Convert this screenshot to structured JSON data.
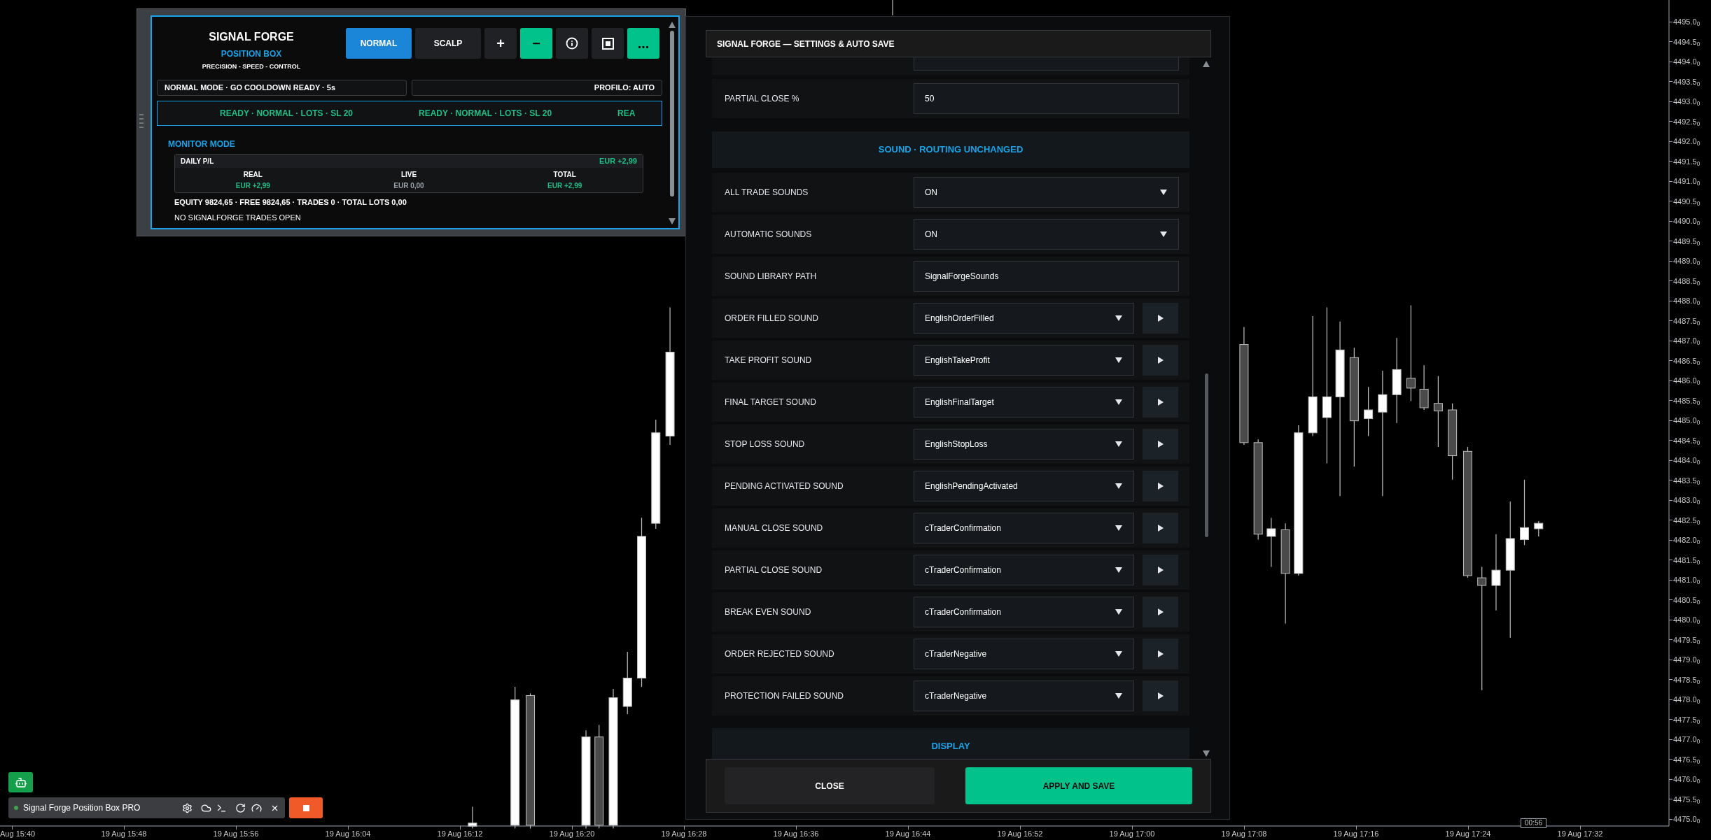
{
  "position_box": {
    "title": "SIGNAL FORGE",
    "subtitle": "POSITION BOX",
    "tagline": "PRECISION - SPEED - CONTROL",
    "buttons": [
      {
        "kind": "mode",
        "label": "NORMAL",
        "selected": true
      },
      {
        "kind": "mode",
        "label": "SCALP",
        "selected": false
      },
      {
        "kind": "glyph",
        "label": "+",
        "highlighted": false
      },
      {
        "kind": "glyph",
        "label": "−",
        "highlighted": true
      },
      {
        "kind": "info",
        "highlighted": false
      },
      {
        "kind": "window",
        "highlighted": false
      },
      {
        "kind": "glyph",
        "label": "...",
        "highlighted": true
      }
    ],
    "status_left": "NORMAL MODE · GO COOLDOWN READY · 5s",
    "status_right": "PROFILO: AUTO",
    "ticker": [
      "READY · NORMAL · LOTS · SL 20",
      "READY · NORMAL · LOTS · SL 20",
      "REA"
    ],
    "monitor_title": "MONITOR MODE",
    "daily_pl": {
      "label": "DAILY P/L",
      "value": "EUR +2,99",
      "columns": [
        {
          "label": "REAL",
          "value": "EUR +2,99",
          "color": "#1fbf86"
        },
        {
          "label": "LIVE",
          "value": "EUR 0,00",
          "color": "#9aa3ad"
        },
        {
          "label": "TOTAL",
          "value": "EUR +2,99",
          "color": "#1fbf86"
        }
      ]
    },
    "equity_line": "EQUITY 9824,65 · FREE 9824,65 · TRADES 0 · TOTAL LOTS 0,00",
    "trades_line": "NO SIGNALFORGE TRADES OPEN"
  },
  "settings": {
    "title": "SIGNAL FORGE — SETTINGS & AUTO SAVE",
    "rows": [
      {
        "kind": "input",
        "label": "PARTIAL CLOSE %",
        "value": "50"
      },
      {
        "kind": "section",
        "label": "SOUND · ROUTING UNCHANGED"
      },
      {
        "kind": "select",
        "label": "ALL TRADE SOUNDS",
        "value": "ON"
      },
      {
        "kind": "select",
        "label": "AUTOMATIC SOUNDS",
        "value": "ON"
      },
      {
        "kind": "input",
        "label": "SOUND LIBRARY PATH",
        "value": "SignalForgeSounds"
      },
      {
        "kind": "sound",
        "label": "ORDER FILLED SOUND",
        "value": "EnglishOrderFilled"
      },
      {
        "kind": "sound",
        "label": "TAKE PROFIT SOUND",
        "value": "EnglishTakeProfit"
      },
      {
        "kind": "sound",
        "label": "FINAL TARGET SOUND",
        "value": "EnglishFinalTarget"
      },
      {
        "kind": "sound",
        "label": "STOP LOSS SOUND",
        "value": "EnglishStopLoss"
      },
      {
        "kind": "sound",
        "label": "PENDING ACTIVATED SOUND",
        "value": "EnglishPendingActivated"
      },
      {
        "kind": "sound",
        "label": "MANUAL CLOSE SOUND",
        "value": "cTraderConfirmation"
      },
      {
        "kind": "sound",
        "label": "PARTIAL CLOSE SOUND",
        "value": "cTraderConfirmation"
      },
      {
        "kind": "sound",
        "label": "BREAK EVEN SOUND",
        "value": "cTraderConfirmation"
      },
      {
        "kind": "sound",
        "label": "ORDER REJECTED SOUND",
        "value": "cTraderNegative"
      },
      {
        "kind": "sound",
        "label": "PROTECTION FAILED SOUND",
        "value": "cTraderNegative"
      },
      {
        "kind": "section",
        "label": "DISPLAY"
      }
    ],
    "close_button": "CLOSE",
    "apply_button": "APPLY AND SAVE"
  },
  "bot_bar": {
    "name": "Signal Forge Position Box PRO"
  },
  "price_axis": [
    "4495.0$_{0}$",
    "4494.5$_{0}$",
    "4494.0$_{0}$",
    "4493.5$_{0}$",
    "4493.0$_{0}$",
    "4492.5$_{0}$",
    "4492.0$_{0}$",
    "4491.5$_{0}$",
    "4491.0$_{0}$",
    "4490.5$_{0}$",
    "4490.0$_{0}$",
    "4489.5$_{0}$",
    "4489.0$_{0}$",
    "4488.5$_{0}$",
    "4488.0$_{0}$",
    "4487.5$_{0}$",
    "4487.0$_{0}$",
    "4486.5$_{0}$",
    "4486.0$_{0}$",
    "4485.5$_{0}$",
    "4485.0$_{0}$",
    "4484.5$_{0}$",
    "4484.0$_{0}$",
    "4483.5$_{0}$",
    "4483.0$_{0}$",
    "4482.5$_{0}$",
    "4482.0$_{0}$",
    "4481.5$_{0}$",
    "4481.0$_{0}$",
    "4480.5$_{0}$",
    "4480.0$_{0}$",
    "4479.5$_{0}$",
    "4479.0$_{0}$",
    "4478.5$_{0}$",
    "4478.0$_{0}$",
    "4477.5$_{0}$",
    "4477.0$_{0}$",
    "4476.5$_{0}$",
    "4476.0$_{0}$",
    "4475.5$_{0}$",
    "4475.0$_{0}$"
  ],
  "time_axis": [
    "Aug 15:40",
    "19 Aug 15:48",
    "19 Aug 15:56",
    "19 Aug 16:04",
    "19 Aug 16:12",
    "19 Aug 16:20",
    "19 Aug 16:28",
    "19 Aug 16:36",
    "19 Aug 16:44",
    "19 Aug 16:52",
    "19 Aug 17:00",
    "19 Aug 17:08",
    "19 Aug 17:16",
    "19 Aug 17:24",
    "19 Aug 17:32"
  ],
  "countdown": "00:56"
}
